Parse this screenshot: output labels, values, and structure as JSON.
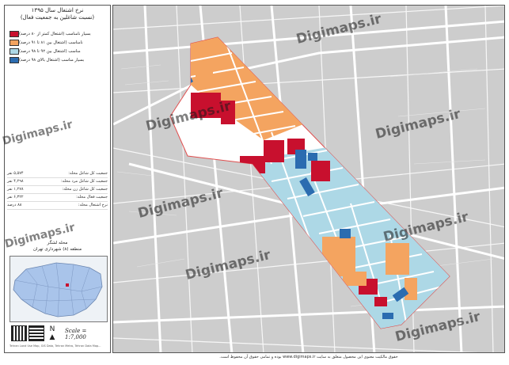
{
  "legend_panel": {
    "title_line1": "نرخ اشتغال سال ۱۳۹۵",
    "title_line2": "(نسبت شاغلین به جمعیت فعال)",
    "legend": [
      {
        "label": "بسیار نامناسب (اشتغال کمتر از ۸۰ درصد)",
        "color": "#c8102e"
      },
      {
        "label": "نامناسب (اشتغال بین ۸۱ تا ۹۱ درصد)",
        "color": "#f4a460"
      },
      {
        "label": "مناسب (اشتغال بین ۹۲ تا ۹۸ درصد)",
        "color": "#add8e6"
      },
      {
        "label": "بسیار مناسب (اشتغال بالای ۹۸ درصد)",
        "color": "#2b6cb0"
      }
    ],
    "stats": [
      {
        "label": "جمعیت کل شاغل محله:",
        "value": "۵,۵۷۴ نفر"
      },
      {
        "label": "جمعیت کل شاغل مرد محله:",
        "value": "۴,۲۹۸ نفر"
      },
      {
        "label": "جمعیت کل شاغل زن محله:",
        "value": "۱,۲۷۸ نفر"
      },
      {
        "label": "جمعیت فعال محله:",
        "value": "۶,۳۲۲ نفر"
      },
      {
        "label": "نرخ اشتغال محله:",
        "value": "۸۸ درصد"
      }
    ],
    "location_line1": "محله لشگر",
    "location_line2": "منطقه (۸) شهرداری تهران",
    "scale": "Scale = 1:7,000",
    "credit": "Tehran Land Use Map, GIS Data, Tehran Metro, Tehran Data Map..."
  },
  "footer": "حقوق مالکیت معنوی این محصول متعلق به سایت www.digimaps.ir بوده و تمامی حقوق آن محفوظ است.",
  "watermark": "Digimaps.ir",
  "icons": {
    "north_arrow": "north-arrow-icon",
    "qr": "qr-code-icon"
  }
}
